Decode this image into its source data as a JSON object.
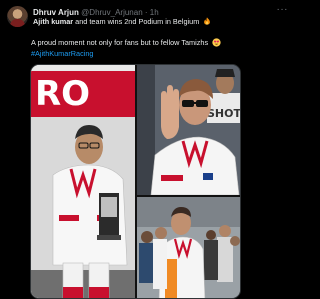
{
  "tweet": {
    "author_name": "Dhruv Arjun",
    "author_handle": "@Dhruv_Arjunan",
    "separator": "·",
    "time": "1h",
    "more_label": "···",
    "line1_bold": "Ajith kumar",
    "line1_rest": " and team wins 2nd Podium in Belgium",
    "line2": "A proud moment not only for fans but to fellow Tamizhs",
    "hashtag": "#AjithKumarRacing",
    "icons": {
      "line1": "fire-icon",
      "line2": "heart-eyes-icon"
    }
  },
  "media": {
    "photo_left": {
      "banner_text": "RO"
    },
    "photo_right_top": {
      "banner_text": "SHOT"
    }
  },
  "colors": {
    "background": "#000000",
    "link": "#1d9bf0",
    "muted": "#71767b",
    "text": "#e7e9ea"
  }
}
